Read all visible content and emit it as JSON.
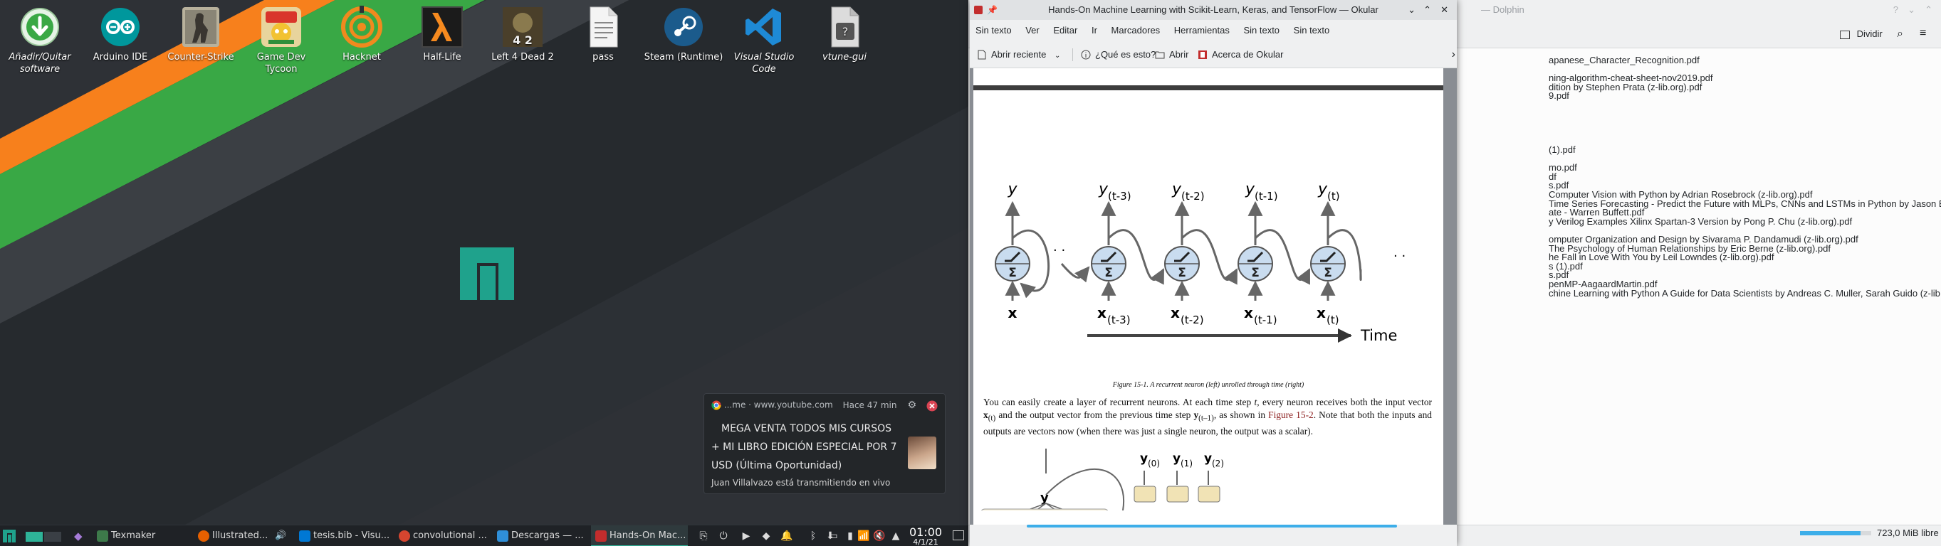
{
  "desktop": {
    "icons": [
      {
        "label": "Añadir/Quitar software",
        "italic": true,
        "icon": "download-icon"
      },
      {
        "label": "Arduino IDE",
        "italic": false,
        "icon": "arduino-icon"
      },
      {
        "label": "Counter-Strike",
        "italic": false,
        "icon": "counter-strike-icon"
      },
      {
        "label": "Game Dev Tycoon",
        "italic": false,
        "icon": "game-dev-tycoon-icon"
      },
      {
        "label": "Hacknet",
        "italic": false,
        "icon": "hacknet-icon"
      },
      {
        "label": "Half-Life",
        "italic": false,
        "icon": "half-life-icon"
      },
      {
        "label": "Left 4 Dead 2",
        "italic": false,
        "icon": "left4dead2-icon"
      },
      {
        "label": "pass",
        "italic": false,
        "icon": "text-file-icon"
      },
      {
        "label": "Steam (Runtime)",
        "italic": false,
        "icon": "steam-icon"
      },
      {
        "label": "Visual Studio Code",
        "italic": true,
        "icon": "vscode-icon"
      },
      {
        "label": "vtune-gui",
        "italic": true,
        "icon": "unknown-file-icon"
      }
    ]
  },
  "notification": {
    "source": "...me · www.youtube.com",
    "time": "Hace 47 min",
    "body": " MEGA VENTA TODOS MIS CURSOS + MI LIBRO EDICIÓN ESPECIAL POR 7 USD (Última Oportunidad)",
    "subtitle": "Juan Villalvazo está transmitiendo en vivo"
  },
  "taskbar": {
    "tasks": [
      {
        "label": "Texmaker",
        "color": "#3d7a4a"
      },
      {
        "label": "Illustrated...",
        "color": "#e66000"
      },
      {
        "label": "tesis.bib - Visu...",
        "color": "#0078d4"
      },
      {
        "label": "convolutional ...",
        "color": "#d6452f"
      },
      {
        "label": "Descargas — ...",
        "color": "#2f8fd8"
      },
      {
        "label": "Hands-On Mac...",
        "color": "#c22d2d"
      }
    ],
    "clock_time": "01:00",
    "clock_date": "4/1/21"
  },
  "dolphin": {
    "title": "— Dolphin",
    "split_label": "Dividir",
    "files": [
      "apanese_Character_Recognition.pdf",
      "",
      "ning-algorithm-cheat-sheet-nov2019.pdf",
      "dition by Stephen Prata (z-lib.org).pdf",
      "9.pdf",
      "",
      "",
      "",
      "",
      "",
      "(1).pdf",
      "",
      "mo.pdf",
      "df",
      "s.pdf",
      "Computer Vision with Python by Adrian Rosebrock (z-lib.org).pdf",
      "Time Series Forecasting - Predict the Future with MLPs, CNNs and LSTMs in Python by Jason Brownlee (z-lib.org).",
      "ate - Warren Buffett.pdf",
      "y Verilog Examples Xilinx Spartan-3 Version by Pong P. Chu (z-lib.org).pdf",
      "",
      "omputer Organization and Design by Sivarama P. Dandamudi (z-lib.org).pdf",
      "The Psychology of Human Relationships by Eric Berne (z-lib.org).pdf",
      "he Fall in Love With You by Leil Lowndes (z-lib.org).pdf",
      "s (1).pdf",
      "s.pdf",
      "penMP-AagaardMartin.pdf",
      "chine Learning with Python A Guide for Data Scientists by Andreas C. Muller, Sarah Guido (z-lib.org).pdf"
    ],
    "free_space": "723,0 MiB libre"
  },
  "okular": {
    "title": "Hands-On Machine Learning with Scikit-Learn, Keras, and TensorFlow — Okular",
    "menu": [
      "Sin texto",
      "Ver",
      "Editar",
      "Ir",
      "Marcadores",
      "Herramientas",
      "Sin texto",
      "Sin texto"
    ],
    "toolbar": {
      "recent": "Abrir reciente",
      "whats_this": "¿Qué es esto?",
      "open": "Abrir",
      "about": "Acerca de Okular"
    },
    "figure": {
      "single_y": "y",
      "single_x": "x",
      "y_subs": [
        "(t-3)",
        "(t-2)",
        "(t-1)",
        "(t)"
      ],
      "x_subs": [
        "(t-3)",
        "(t-2)",
        "(t-1)",
        "(t)"
      ],
      "time_label": "Time",
      "bottom_y_subs": [
        "(0)",
        "(1)",
        "(2)"
      ]
    },
    "caption": "Figure 15-1. A recurrent neuron (left) unrolled through time (right)",
    "paragraph": {
      "p1": "You can easily create a layer of recurrent neurons. At each time step ",
      "t": "t",
      "p2": ", every neuron receives both the input vector ",
      "xvec": "x",
      "xsub": "(t)",
      "p3": " and the output vector from the previous time step ",
      "yvec": "y",
      "ysub": "(t–1)",
      "p4": ", as shown in ",
      "ref": "Figure 15-2",
      "p5": ". Note that both the inputs and outputs are vectors now (when there was just a single neuron, the output was a scalar)."
    }
  }
}
